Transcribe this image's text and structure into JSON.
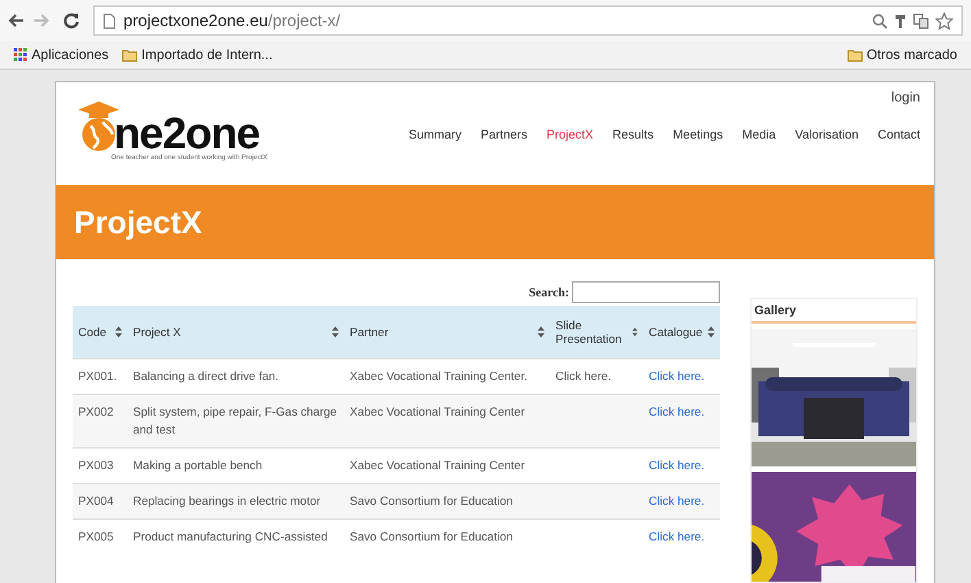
{
  "browser": {
    "url_host": "projectxone2one.eu",
    "url_path": "/project-x/",
    "bookmarks": [
      {
        "label": "Aplicaciones",
        "kind": "apps"
      },
      {
        "label": "Importado de Intern...",
        "kind": "folder"
      }
    ],
    "other_bookmarks": "Otros marcado"
  },
  "site": {
    "login": "login",
    "logo": {
      "text": "ne2one",
      "tagline": "One teacher and one student working with ProjectX"
    },
    "nav": [
      {
        "label": "Summary",
        "selected": false
      },
      {
        "label": "Partners",
        "selected": false
      },
      {
        "label": "ProjectX",
        "selected": true
      },
      {
        "label": "Results",
        "selected": false
      },
      {
        "label": "Meetings",
        "selected": false
      },
      {
        "label": "Media",
        "selected": false
      },
      {
        "label": "Valorisation",
        "selected": false
      },
      {
        "label": "Contact",
        "selected": false
      }
    ],
    "banner_title": "ProjectX"
  },
  "search": {
    "label": "Search:"
  },
  "table": {
    "columns": [
      "Code",
      "Project X",
      "Partner",
      "Slide Presentation",
      "Catalogue"
    ],
    "rows": [
      {
        "code": "PX001.",
        "project": "Balancing a direct drive fan.",
        "partner": "Xabec Vocational Training Center.",
        "slide": "Click here.",
        "catalogue": "Click here."
      },
      {
        "code": "PX002",
        "project": "Split system, pipe repair, F-Gas charge and test",
        "partner": "Xabec Vocational Training Center",
        "catalogue": "Click here."
      },
      {
        "code": "PX003",
        "project": "Making a portable bench",
        "partner": "Xabec Vocational Training Center",
        "catalogue": "Click here."
      },
      {
        "code": "PX004",
        "project": "Replacing bearings in electric motor",
        "partner": "Savo Consortium for Education",
        "catalogue": "Click here."
      },
      {
        "code": "PX005",
        "project": "Product manufacturing CNC-assisted",
        "partner": "Savo Consortium for Education",
        "catalogue": "Click here."
      }
    ]
  },
  "gallery": {
    "title": "Gallery"
  }
}
